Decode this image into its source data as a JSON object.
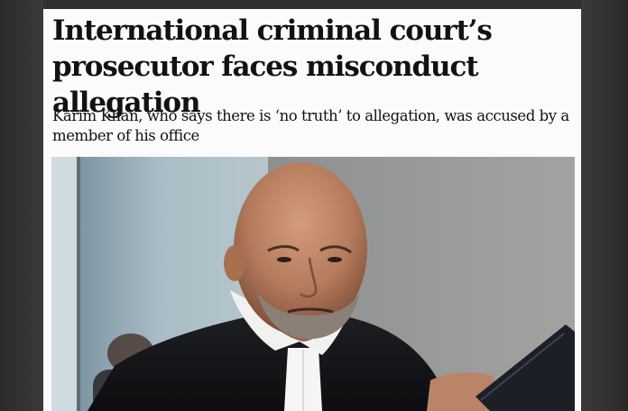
{
  "article": {
    "headline": "International criminal court’s prosecutor faces misconduct allegation",
    "standfirst": "Karim Khan, who says there is ‘no truth’ to allegation, was accused by a member of his office"
  },
  "colors": {
    "page_background": "#fbfbfb",
    "text": "#121212",
    "surround": "#2b2b2b"
  }
}
